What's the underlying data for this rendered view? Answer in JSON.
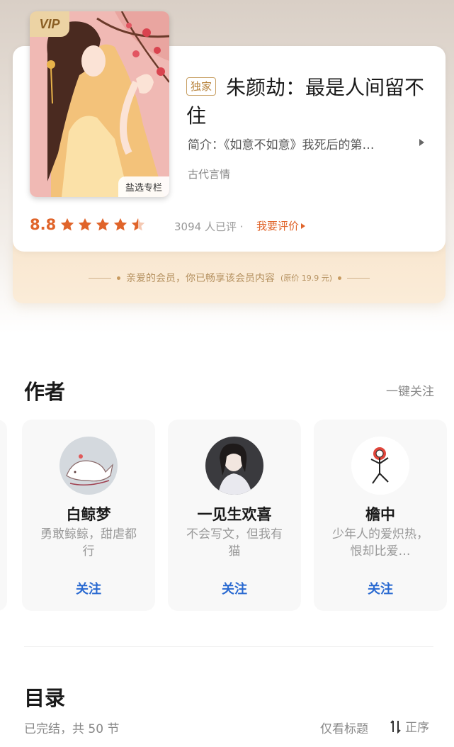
{
  "book": {
    "vip_badge": "VIP",
    "cover_tag": "盐选专栏",
    "exclusive_tag": "独家",
    "title": "朱颜劫：最是人间留不住",
    "synopsis": "简介：《如意不如意》我死后的第…",
    "genre": "古代言情",
    "rating": "8.8",
    "stars_filled": 4.5,
    "review_count": "3094 人已评 ·",
    "review_link": "我要评价"
  },
  "membership": {
    "text": "亲爱的会员，你已畅享该会员内容",
    "original_price": "(原价 19.9 元)"
  },
  "authors_section": {
    "title": "作者",
    "follow_all": "一键关注",
    "authors": [
      {
        "name": "白鲸梦",
        "bio": "勇敢鲸鲸，甜虐都行",
        "follow": "关注"
      },
      {
        "name": "一见生欢喜",
        "bio": "不会写文，但我有猫",
        "follow": "关注"
      },
      {
        "name": "檐中",
        "bio": "少年人的爱炽热，恨却比爱…",
        "follow": "关注"
      }
    ]
  },
  "catalog": {
    "title": "目录",
    "status": "已完结，共 50 节",
    "view_titles": "仅看标题",
    "sort": "正序"
  },
  "colors": {
    "accent_orange": "#e0642a",
    "link_blue": "#2a6ad1",
    "gold": "#b8843e"
  }
}
